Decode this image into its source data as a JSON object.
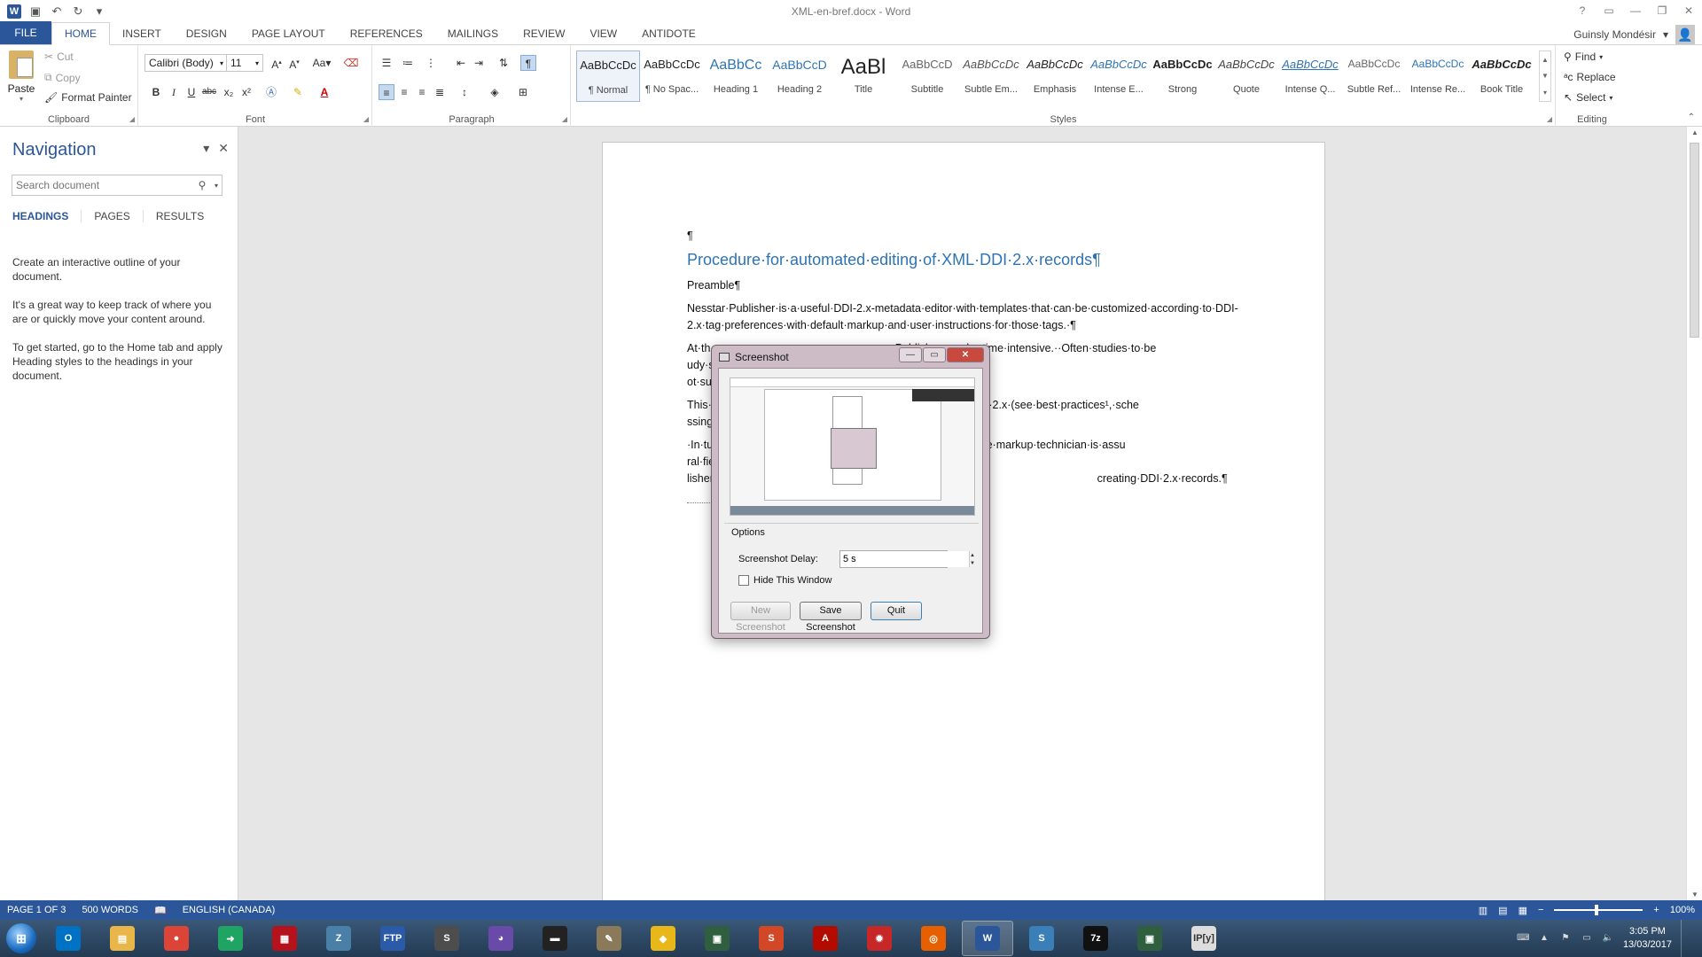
{
  "window": {
    "title": "XML-en-bref.docx - Word",
    "controls": [
      "?",
      "▭",
      "—",
      "❐",
      "✕"
    ]
  },
  "quick_access": {
    "icons": [
      "word-logo",
      "save-icon",
      "undo-icon",
      "redo-icon",
      "customize-icon"
    ]
  },
  "ribbon_tabs": [
    "FILE",
    "HOME",
    "INSERT",
    "DESIGN",
    "PAGE LAYOUT",
    "REFERENCES",
    "MAILINGS",
    "REVIEW",
    "VIEW",
    "ANTIDOTE"
  ],
  "active_tab": "HOME",
  "user": {
    "name": "Guinsly Mondésir"
  },
  "clipboard": {
    "paste": "Paste",
    "cut": "Cut",
    "copy": "Copy",
    "format_painter": "Format Painter",
    "label": "Clipboard"
  },
  "font": {
    "family": "Calibri (Body)",
    "size": "11",
    "label": "Font",
    "case_label": "Aa",
    "buttons": [
      "B",
      "I",
      "U",
      "abc",
      "x₂",
      "x²"
    ]
  },
  "paragraph": {
    "label": "Paragraph"
  },
  "styles": {
    "label": "Styles",
    "items": [
      {
        "sample": "AaBbCcDc",
        "name": "¶ Normal",
        "selected": true
      },
      {
        "sample": "AaBbCcDc",
        "name": "¶ No Spac..."
      },
      {
        "sample": "AaBbCc",
        "name": "Heading 1"
      },
      {
        "sample": "AaBbCcD",
        "name": "Heading 2"
      },
      {
        "sample": "AaBl",
        "name": "Title"
      },
      {
        "sample": "AaBbCcD",
        "name": "Subtitle"
      },
      {
        "sample": "AaBbCcDc",
        "name": "Subtle Em..."
      },
      {
        "sample": "AaBbCcDc",
        "name": "Emphasis"
      },
      {
        "sample": "AaBbCcDc",
        "name": "Intense E..."
      },
      {
        "sample": "AaBbCcDc",
        "name": "Strong"
      },
      {
        "sample": "AaBbCcDc",
        "name": "Quote"
      },
      {
        "sample": "AaBbCcDc",
        "name": "Intense Q..."
      },
      {
        "sample": "AaBbCcDc",
        "name": "Subtle Ref..."
      },
      {
        "sample": "AaBbCcDc",
        "name": "Intense Re..."
      },
      {
        "sample": "AaBbCcDc",
        "name": "Book Title"
      }
    ]
  },
  "editing": {
    "find": "Find",
    "replace": "Replace",
    "select": "Select",
    "label": "Editing"
  },
  "navigation": {
    "title": "Navigation",
    "search_placeholder": "Search document",
    "tabs": [
      "HEADINGS",
      "PAGES",
      "RESULTS"
    ],
    "help": [
      "Create an interactive outline of your document.",
      "It's a great way to keep track of where you are or quickly move your content around.",
      "To get started, go to the Home tab and apply Heading styles to the headings in your document."
    ]
  },
  "document": {
    "pilcrow": "¶",
    "heading": "Procedure·for·automated·editing·of·XML·DDI·2.x·records¶",
    "preamble": "Preamble¶",
    "paragraphs": [
      "Nesstar·Publisher·is·a·useful·DDI-2.x-metadata·editor·with·templates·that·can·be·customized·according·to·DDI-2.x·tag·preferences·with·default·markup·and·user·instructions·for·those·tags.·¶",
      "At·th                                                            Publisher·can·be·time·intensive.··Often·studies·to·be                                                            udy·series·or·longitudinal·study·series.··This·can·                                                             ot·support·batch·editing·of·repeated·meta",
      "This·                                                             he·DDI·Codebook·2.x·(see·best·practices¹,·sche                                                             ssing,·editing·and·publishing·the·completed·meta",
      "·In·tu                                                            diting·template,·the·markup·technician·is·assu                                                             ral·fields,·is·accurately·changed.···By·comp                                                             lisher.··This·automated·procedure·adds·incre                                                             creating·DDI·2.x·records.¶"
    ]
  },
  "dialog": {
    "title": "Screenshot",
    "options_label": "Options",
    "delay_label": "Screenshot Delay:",
    "delay_value": "5 s",
    "hide_label": "Hide This Window",
    "hide_checked": false,
    "buttons": {
      "new": "New Screenshot",
      "save": "Save Screenshot",
      "quit": "Quit"
    }
  },
  "status": {
    "page": "PAGE 1 OF 3",
    "words": "500 WORDS",
    "language": "ENGLISH (CANADA)",
    "zoom": "100%"
  },
  "taskbar": {
    "apps": [
      {
        "name": "outlook",
        "label": "O",
        "color": "#0072c6"
      },
      {
        "name": "explorer",
        "label": "▤",
        "color": "#e9b64a"
      },
      {
        "name": "chrome",
        "label": "●",
        "color": "#db4437"
      },
      {
        "name": "arrow-app",
        "label": "➜",
        "color": "#1fa463"
      },
      {
        "name": "filezilla",
        "label": "▦",
        "color": "#b5121b"
      },
      {
        "name": "remote",
        "label": "Z",
        "color": "#4a7fa8"
      },
      {
        "name": "ftp",
        "label": "FTP",
        "color": "#2a5aa8"
      },
      {
        "name": "sublime",
        "label": "S",
        "color": "#4d4d4d"
      },
      {
        "name": "cat-app",
        "label": "◕",
        "color": "#6a4aa8"
      },
      {
        "name": "terminal",
        "label": "▬",
        "color": "#222"
      },
      {
        "name": "gimp",
        "label": "✎",
        "color": "#8a7a5a"
      },
      {
        "name": "bulb-app",
        "label": "◆",
        "color": "#e8b71a"
      },
      {
        "name": "console-app",
        "label": "▣",
        "color": "#2f5f3f"
      },
      {
        "name": "slides-app",
        "label": "S",
        "color": "#d24726"
      },
      {
        "name": "acrobat",
        "label": "A",
        "color": "#b30b00"
      },
      {
        "name": "gear-app",
        "label": "✹",
        "color": "#c62828"
      },
      {
        "name": "firefox",
        "label": "◎",
        "color": "#e66000"
      },
      {
        "name": "word",
        "label": "W",
        "color": "#2b579a",
        "active": true
      },
      {
        "name": "s-app",
        "label": "S",
        "color": "#3a7fb8"
      },
      {
        "name": "7zip",
        "label": "7z",
        "color": "#111"
      },
      {
        "name": "console2",
        "label": "▣",
        "color": "#2f5f3f"
      },
      {
        "name": "ipython",
        "label": "IP[y]",
        "color": "#dddddd"
      }
    ],
    "time": "3:05 PM",
    "date": "13/03/2017"
  }
}
